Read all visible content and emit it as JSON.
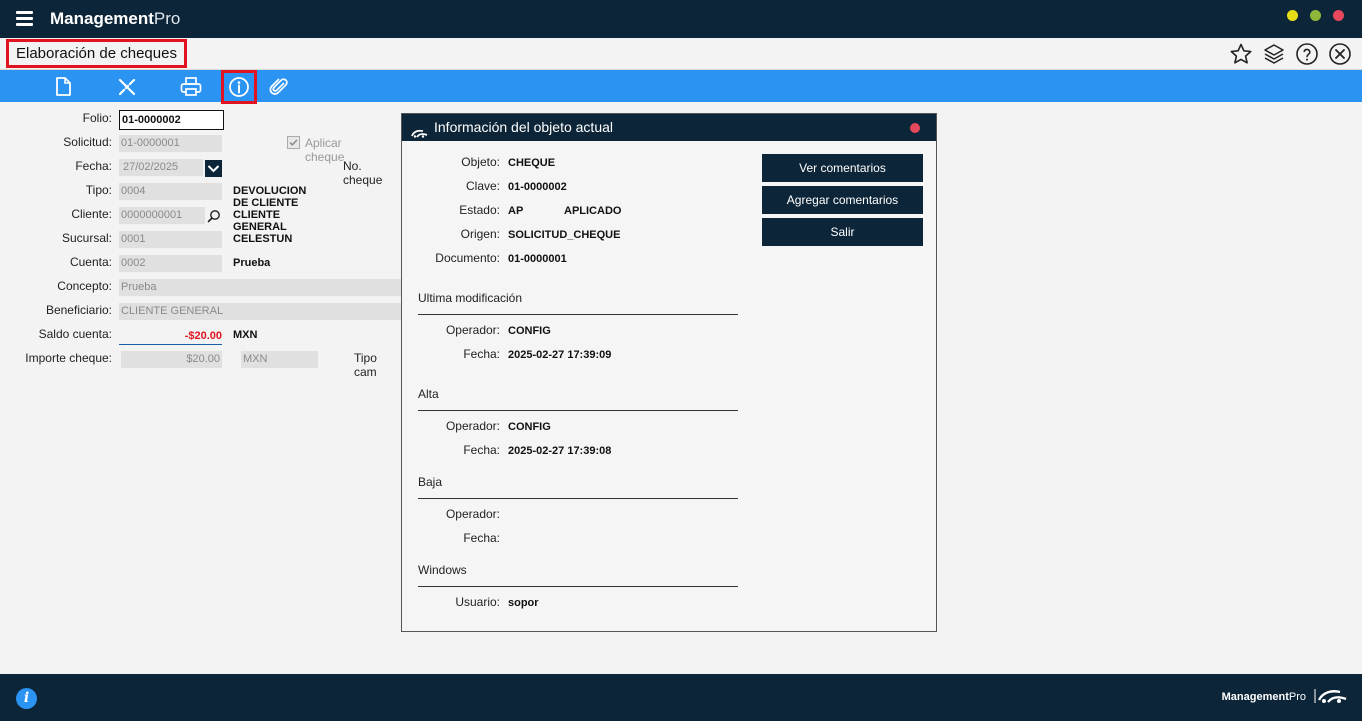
{
  "app": {
    "brand_bold": "Management",
    "brand_light": "Pro",
    "window_buttons": [
      {
        "name": "minimize",
        "color": "#e6dd17"
      },
      {
        "name": "maximize",
        "color": "#8fb63b"
      },
      {
        "name": "close",
        "color": "#e8485c"
      }
    ]
  },
  "page": {
    "title": "Elaboración de cheques"
  },
  "toolbar": {
    "items": [
      "new-document-icon",
      "cancel-icon",
      "print-icon",
      "info-icon",
      "attach-icon"
    ],
    "selected": "info-icon"
  },
  "form": {
    "folio_label": "Folio:",
    "folio_value": "01-0000002",
    "solicitud_label": "Solicitud:",
    "solicitud_value": "01-0000001",
    "aplicar_cheque_label": "Aplicar cheque",
    "aplicar_cheque_checked": true,
    "fecha_label": "Fecha:",
    "fecha_value": "27/02/2025",
    "no_cheque_label": "No. cheque",
    "tipo_label": "Tipo:",
    "tipo_code": "0004",
    "tipo_desc": "DEVOLUCION DE CLIENTE",
    "cliente_label": "Cliente:",
    "cliente_code": "0000000001",
    "cliente_desc": "CLIENTE GENERAL",
    "sucursal_label": "Sucursal:",
    "sucursal_code": "0001",
    "sucursal_desc": "CELESTUN",
    "cuenta_label": "Cuenta:",
    "cuenta_code": "0002",
    "cuenta_desc": "Prueba",
    "concepto_label": "Concepto:",
    "concepto_value": "Prueba",
    "beneficiario_label": "Beneficiario:",
    "beneficiario_value": "CLIENTE GENERAL",
    "saldo_label": "Saldo cuenta:",
    "saldo_value": "-$20.00",
    "saldo_currency": "MXN",
    "importe_label": "Importe cheque:",
    "importe_value": "$20.00",
    "importe_currency": "MXN",
    "tipo_cambio_label": "Tipo cam"
  },
  "dialog": {
    "title": "Información del objeto actual",
    "objeto_label": "Objeto:",
    "objeto_value": "CHEQUE",
    "clave_label": "Clave:",
    "clave_value": "01-0000002",
    "estado_label": "Estado:",
    "estado_code": "AP",
    "estado_desc": "APLICADO",
    "origen_label": "Origen:",
    "origen_value": "SOLICITUD_CHEQUE",
    "documento_label": "Documento:",
    "documento_value": "01-0000001",
    "ultima_section": "Ultima modificación",
    "ultima_operador_label": "Operador:",
    "ultima_operador_value": "CONFIG",
    "ultima_fecha_label": "Fecha:",
    "ultima_fecha_value": "2025-02-27 17:39:09",
    "alta_section": "Alta",
    "alta_operador_label": "Operador:",
    "alta_operador_value": "CONFIG",
    "alta_fecha_label": "Fecha:",
    "alta_fecha_value": "2025-02-27 17:39:08",
    "baja_section": "Baja",
    "baja_operador_label": "Operador:",
    "baja_fecha_label": "Fecha:",
    "windows_section": "Windows",
    "usuario_label": "Usuario:",
    "usuario_value": "sopor",
    "btn_ver": "Ver comentarios",
    "btn_agregar": "Agregar comentarios",
    "btn_salir": "Salir"
  },
  "footer": {
    "brand_bold": "Management",
    "brand_light": "Pro"
  },
  "colors": {
    "navy": "#0d2538",
    "toolbar_blue": "#2b94f3",
    "highlight_red": "#e0141e",
    "negative_red": "#e0141e"
  }
}
